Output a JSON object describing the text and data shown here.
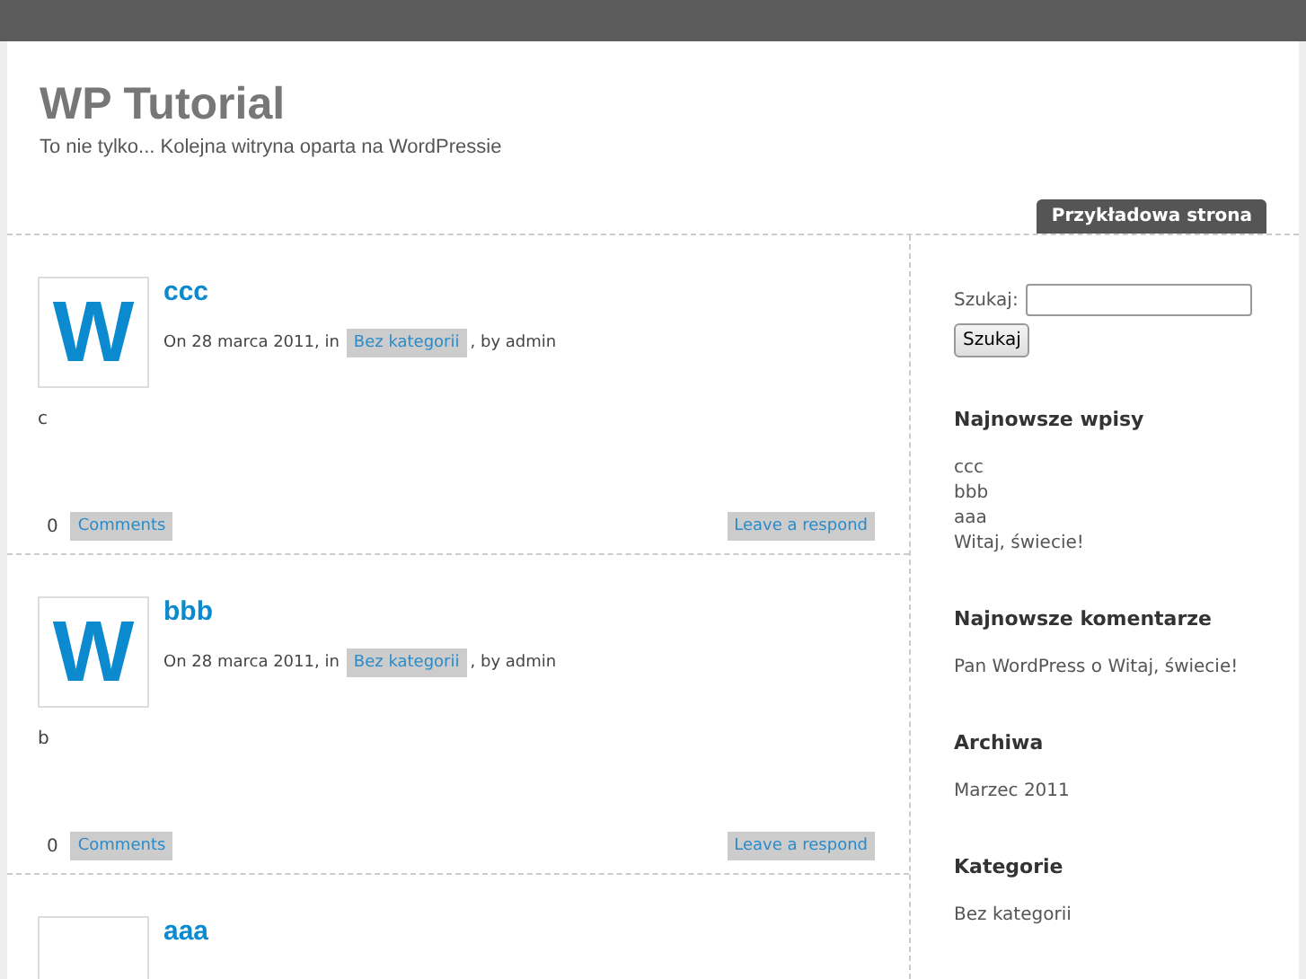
{
  "site": {
    "title": "WP Tutorial",
    "tagline": "To nie tylko... Kolejna witryna oparta na WordPressie"
  },
  "nav": [
    {
      "label": "Przykładowa strona",
      "selected": false
    }
  ],
  "posts": [
    {
      "thumbnail": "W",
      "title": "ccc",
      "meta_before": "On 28 marca 2011, in",
      "category": "Bez kategorii",
      "meta_after": ", by admin",
      "excerpt": "c",
      "comment_count": "0",
      "comments_link": "Comments",
      "respond_link": "Leave a respond"
    },
    {
      "thumbnail": "W",
      "title": "bbb",
      "meta_before": "On 28 marca 2011, in",
      "category": "Bez kategorii",
      "meta_after": ", by admin",
      "excerpt": "b",
      "comment_count": "0",
      "comments_link": "Comments",
      "respond_link": "Leave a respond"
    },
    {
      "title": "aaa"
    }
  ],
  "sidebar": {
    "search_label": "Szukaj:",
    "search_button": "Szukaj",
    "widgets": [
      {
        "title": "Najnowsze wpisy",
        "items": [
          "ccc",
          "bbb",
          "aaa",
          "Witaj, świecie!"
        ]
      },
      {
        "title": "Najnowsze komentarze",
        "items": [
          "Pan WordPress o Witaj, świecie!"
        ]
      },
      {
        "title": "Archiwa",
        "items": [
          "Marzec 2011"
        ]
      },
      {
        "title": "Kategorie",
        "items": [
          "Bez kategorii"
        ]
      }
    ]
  }
}
